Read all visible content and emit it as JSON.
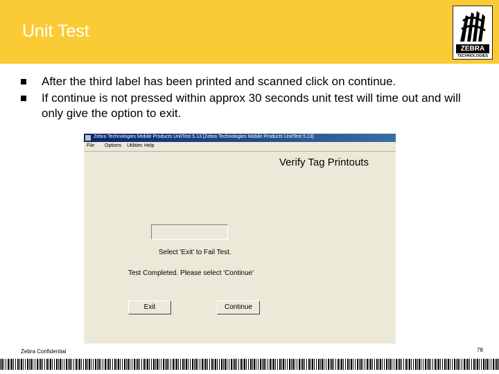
{
  "slide": {
    "title": "Unit Test",
    "bullets": [
      "After the third label has been printed and scanned click on continue.",
      "If continue is not pressed within approx 30 seconds unit test will time out and will only give the option to exit."
    ],
    "footer": "Zebra Confidential",
    "page_number": "78"
  },
  "logo": {
    "brand": "ZEBRA",
    "tagline": "TECHNOLOGIES"
  },
  "window": {
    "title": "Zebra Technologies Mobile Products UnitTest 5.13    [Zebra Technologies Mobile Products UnitTest 5.13]",
    "menu": [
      "File",
      "Options",
      "Utilities",
      "Help"
    ],
    "heading": "Verify Tag Printouts",
    "input_value": "",
    "fail_text": "Select 'Exit' to Fail Test.",
    "status_text": "Test Completed.  Please select 'Continue'",
    "buttons": {
      "exit": "Exit",
      "continue": "Continue"
    }
  },
  "colors": {
    "header_bg": "#fbcb35",
    "title_bar": "#0a246a",
    "window_bg": "#ece9d8"
  }
}
